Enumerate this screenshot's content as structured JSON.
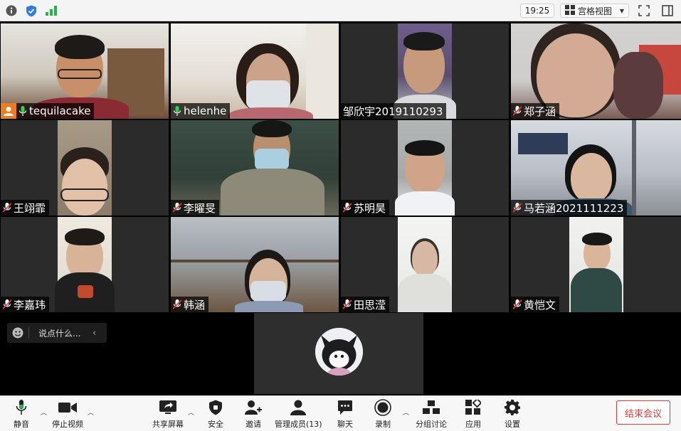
{
  "topbar": {
    "time": "19:25",
    "view_label": "宫格视图",
    "icons": [
      "info-icon",
      "shield-icon",
      "signal-icon",
      "grid-icon",
      "chevron-down-icon",
      "fullscreen-icon",
      "sidebar-icon"
    ]
  },
  "participants": [
    {
      "name": "tequilacake",
      "mic": "on",
      "host": true
    },
    {
      "name": "helenhe",
      "mic": "on",
      "active": true
    },
    {
      "name": "邹欣宇2019110293",
      "mic": "none"
    },
    {
      "name": "郑子涵",
      "mic": "muted"
    },
    {
      "name": "王翊霏",
      "mic": "muted"
    },
    {
      "name": "李曜旻",
      "mic": "muted"
    },
    {
      "name": "苏明昊",
      "mic": "muted"
    },
    {
      "name": "马若涵2021111223",
      "mic": "muted"
    },
    {
      "name": "李嘉玮",
      "mic": "muted"
    },
    {
      "name": "韩涵",
      "mic": "muted"
    },
    {
      "name": "田思滢",
      "mic": "muted"
    },
    {
      "name": "黄恺文",
      "mic": "muted"
    }
  ],
  "chat": {
    "placeholder": "说点什么...",
    "icons": [
      "emoji-icon",
      "chevron-left-icon"
    ]
  },
  "toolbar": {
    "mute_label": "静音",
    "stop_video_label": "停止视频",
    "share_label": "共享屏幕",
    "security_label": "安全",
    "invite_label": "邀请",
    "members_label": "管理成员(13)",
    "chat_label": "聊天",
    "record_label": "录制",
    "breakout_label": "分组讨论",
    "apps_label": "应用",
    "settings_label": "设置",
    "end_label": "结束会议"
  },
  "colors": {
    "accent_green": "#2fd15a",
    "host_orange": "#f07c1c",
    "end_red": "#e53935",
    "muted_red": "#e53935"
  }
}
